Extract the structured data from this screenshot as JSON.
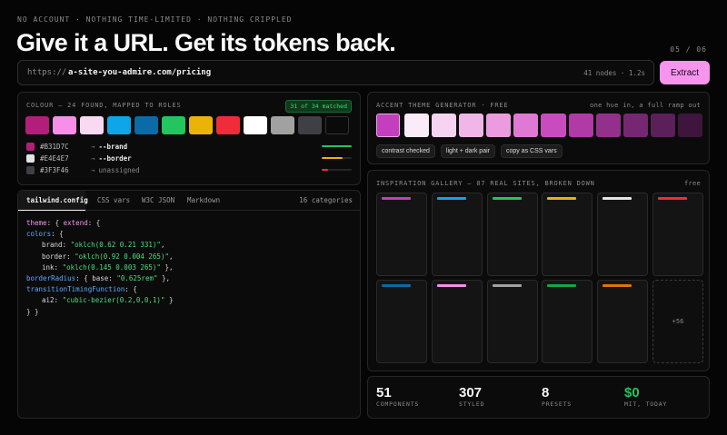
{
  "eyebrow": "NO ACCOUNT · NOTHING TIME-LIMITED · NOTHING CRIPPLED",
  "headline": "Give it a URL. Get its tokens back.",
  "step": "05 / 06",
  "url": {
    "prefix": "https://",
    "value": "a-site-you-admire.com/pricing",
    "meta": "41 nodes · 1.2s",
    "extract_label": "Extract"
  },
  "colour_panel": {
    "label": "COLOUR — 24 FOUND, MAPPED TO ROLES",
    "badge": "31 of 34 matched",
    "swatches": [
      "#B31D7C",
      "#F78FE8",
      "#F9D8F2",
      "#0EA5E9",
      "#0C6AA6",
      "#22C55E",
      "#EAB308",
      "#EF2D3A",
      "#FFFFFF",
      "#A1A1A1",
      "#3F3F46",
      "#0A0A0A"
    ],
    "rows": [
      {
        "swatch": "#B31D7C",
        "hex": "#B31D7C",
        "arrow": "→",
        "role": "--brand",
        "fill": 1.0,
        "bar_color": "#22c55e"
      },
      {
        "swatch": "#E4E4E7",
        "hex": "#E4E4E7",
        "arrow": "→",
        "role": "--border",
        "fill": 0.7,
        "bar_color": "#eab308"
      },
      {
        "swatch": "#3F3F46",
        "hex": "#3F3F46",
        "arrow": "→",
        "role": "unassigned",
        "fill": 0.2,
        "bar_color": "#ef2d3a"
      }
    ]
  },
  "code_panel": {
    "tabs": [
      "tailwind.config",
      "CSS vars",
      "W3C JSON",
      "Markdown"
    ],
    "meta": "16 categories",
    "lines": {
      "l1a": "theme",
      "l1b": ": { ",
      "l1c": "extend",
      "l1d": ": {",
      "l2a": "colors",
      "l2b": ": {",
      "l3a": "brand: ",
      "l3b": "\"oklch(0.62 0.21 331)\"",
      "l3c": ",",
      "l4a": "border: ",
      "l4b": "\"oklch(0.92 0.004 265)\"",
      "l4c": ",",
      "l5a": "ink: ",
      "l5b": "\"oklch(0.145 0.003 265)\"",
      "l5c": " },",
      "l6a": "borderRadius",
      "l6b": ": { base: ",
      "l6c": "\"0.625rem\"",
      "l6d": " },",
      "l7a": "transitionTimingFunction",
      "l7b": ": {",
      "l8a": "ai2: ",
      "l8b": "\"cubic-bezier(0.2,0,0,1)\"",
      "l8c": " }",
      "l9": "} }"
    }
  },
  "accent_panel": {
    "label": "ACCENT THEME GENERATOR · FREE",
    "meta": "one hue in, a full ramp out",
    "base": "#C33FBE",
    "ramp": [
      "#FBEAF8",
      "#F6D3F0",
      "#F0B6E7",
      "#EA9CDF",
      "#DF79D4",
      "#C94CBF",
      "#B03AA6",
      "#93308B",
      "#752771",
      "#5B1F59",
      "#3E163D"
    ],
    "chips": [
      "contrast checked",
      "light + dark pair",
      "copy as CSS vars"
    ]
  },
  "gallery": {
    "label": "INSPIRATION GALLERY — 87 REAL SITES, BROKEN DOWN",
    "meta": "free",
    "bars": [
      "#C33FBE",
      "#0EA5E9",
      "#22C55E",
      "#EAB308",
      "#E5E5E5",
      "#EF2D3A",
      "#0C6AA6",
      "#F78FE8",
      "#A1A1A1",
      "#16A34A",
      "#D97706"
    ],
    "more": "+56"
  },
  "stats": [
    {
      "value": "51",
      "label": "COMPONENTS",
      "color": "#f5f5f5"
    },
    {
      "value": "307",
      "label": "STYLED",
      "color": "#f5f5f5"
    },
    {
      "value": "8",
      "label": "PRESETS",
      "color": "#f5f5f5"
    },
    {
      "value": "$0",
      "label": "MIT, TODAY",
      "color": "#22c55e"
    }
  ]
}
